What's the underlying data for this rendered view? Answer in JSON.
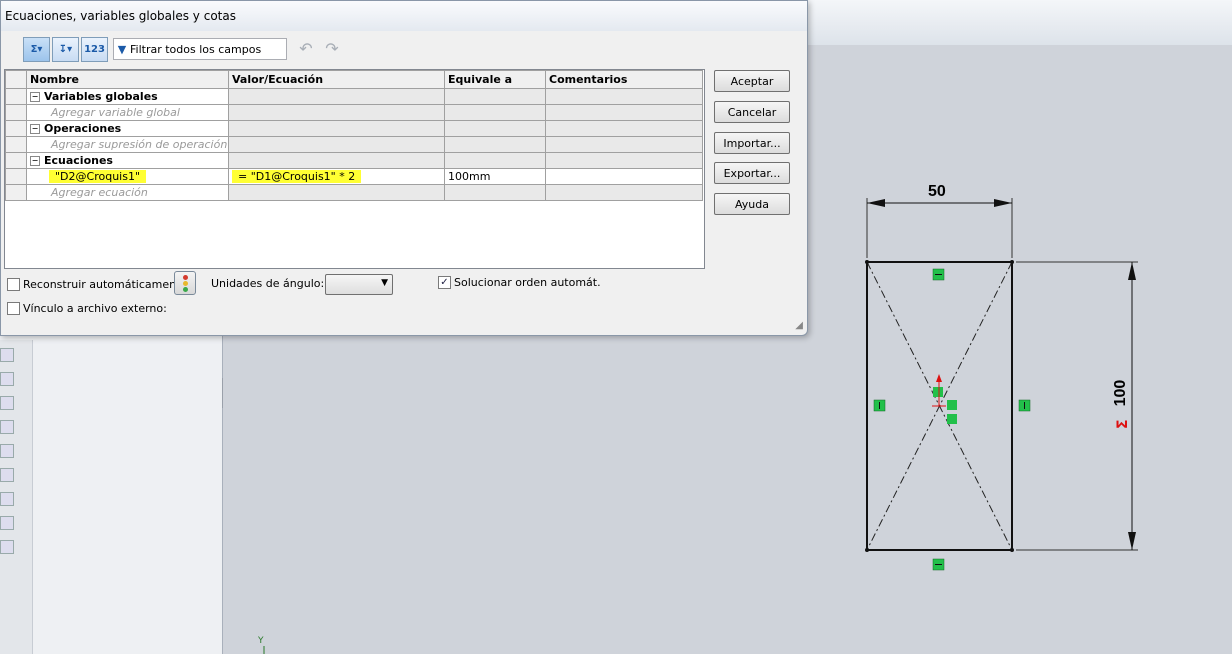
{
  "dialog": {
    "title": "Ecuaciones, variables globales y cotas",
    "filter_placeholder": "Filtrar todos los campos",
    "toolbar_icons": [
      "sigma-view-icon",
      "sort-view-icon",
      "numeric-view-icon"
    ],
    "columns": [
      "Nombre",
      "Valor/Ecuación",
      "Equivale a",
      "Comentarios"
    ],
    "groups": {
      "global_vars": {
        "label": "Variables globales",
        "add_placeholder": "Agregar variable global"
      },
      "operations": {
        "label": "Operaciones",
        "add_placeholder": "Agregar supresión de operación"
      },
      "equations": {
        "label": "Ecuaciones",
        "rows": [
          {
            "name": "\"D2@Croquis1\"",
            "value": "= \"D1@Croquis1\" * 2",
            "equals": "100mm",
            "comment": ""
          }
        ],
        "add_placeholder": "Agregar ecuación"
      }
    },
    "buttons": {
      "accept": "Aceptar",
      "cancel": "Cancelar",
      "import": "Importar...",
      "export": "Exportar...",
      "help": "Ayuda"
    },
    "options": {
      "auto_rebuild": "Reconstruir automáticamente",
      "angle_units": "Unidades de ángulo:",
      "angle_units_value": "",
      "auto_solve": "Solucionar orden automát.",
      "external_link": "Vínculo a archivo externo:"
    },
    "highlight_color": "#ffff33"
  },
  "sketch": {
    "width_dim": "50",
    "height_dim": "100",
    "axis_label": "Y"
  }
}
